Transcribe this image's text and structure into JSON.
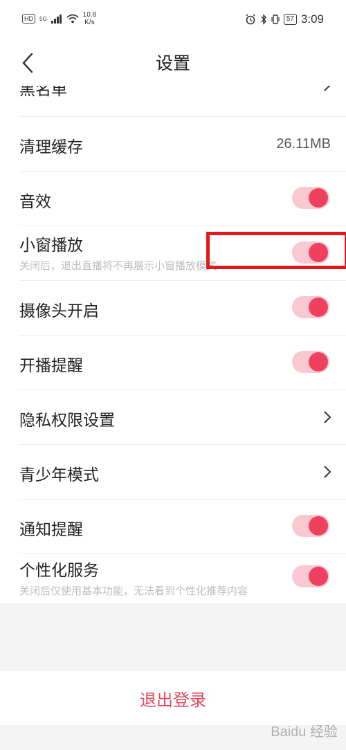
{
  "status_bar": {
    "hd": "HD",
    "signal": "5G",
    "speed_value": "10.8",
    "speed_unit": "K/s",
    "battery": "57",
    "time": "3:09"
  },
  "header": {
    "title": "设置",
    "back_icon": "chevron-left-icon"
  },
  "settings": {
    "blacklist": {
      "label": "黑名单"
    },
    "clear_cache": {
      "label": "清理缓存",
      "value": "26.11MB"
    },
    "sound": {
      "label": "音效",
      "enabled": true
    },
    "mini_window": {
      "label": "小窗播放",
      "desc": "关闭后，退出直播将不再展示小窗播放模式",
      "enabled": true
    },
    "camera": {
      "label": "摄像头开启",
      "enabled": true
    },
    "live_reminder": {
      "label": "开播提醒",
      "enabled": true
    },
    "privacy": {
      "label": "隐私权限设置"
    },
    "teen_mode": {
      "label": "青少年模式"
    },
    "notifications": {
      "label": "通知提醒",
      "enabled": true
    },
    "personalized": {
      "label": "个性化服务",
      "desc": "关闭后仅使用基本功能，无法看到个性化推荐内容",
      "enabled": true
    }
  },
  "logout": {
    "label": "退出登录"
  },
  "colors": {
    "accent": "#f0405f",
    "track": "#f9c9d1",
    "logout_text": "#e6465b",
    "highlight": "#e01a1a"
  },
  "watermark": "Baidu 经验"
}
